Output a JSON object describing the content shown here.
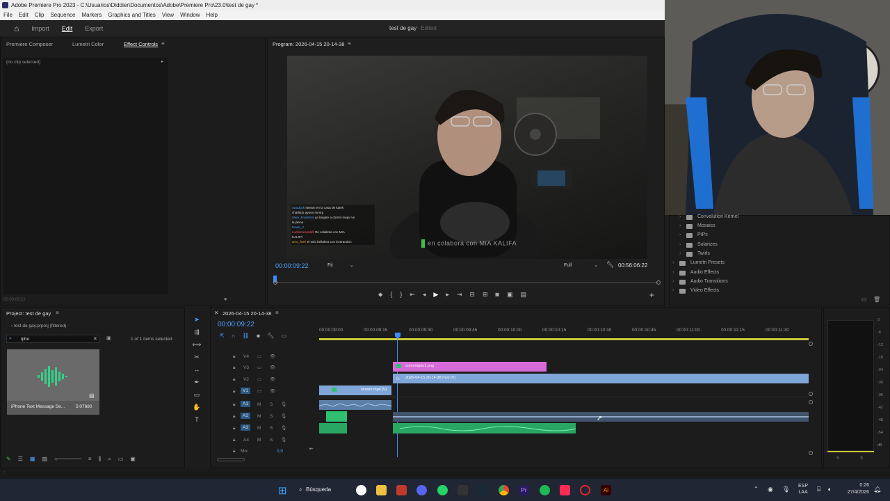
{
  "titlebar": {
    "title": "Adobe Premiere Pro 2023 - C:\\Usuarios\\Diddier\\Documentos\\Adobe\\Premiere Pro\\23.0\\test de gay *"
  },
  "menu": [
    "File",
    "Edit",
    "Clip",
    "Sequence",
    "Markers",
    "Graphics and Titles",
    "View",
    "Window",
    "Help"
  ],
  "workspace": {
    "tabs": [
      "Import",
      "Edit",
      "Export"
    ],
    "active": "Edit",
    "doc_title": "test de gay",
    "doc_status": "Edited"
  },
  "source_panel": {
    "tabs": [
      "Premiere Composer",
      "Lumetri Color",
      "Effect Controls"
    ],
    "active": "Effect Controls",
    "no_clip": "(no clip selected)",
    "timecode": "00:00:09:22"
  },
  "program": {
    "title": "Program: 2026-04-15 20-14-38",
    "timecode": "00:00:09:22",
    "fit": "Fit",
    "quality": "Full",
    "duration": "00:56:06:22",
    "caption": "en colabora con MIA KALIFA",
    "chat": [
      {
        "user": "uwuduck",
        "msg": "stream en la casa de kaleh",
        "color": "#4ea0ff"
      },
      {
        "user": "charlitdo",
        "msg": "ayooo nvmrg",
        "color": "#dddddd"
      },
      {
        "user": "Mary_broderick",
        "msg": "ya lárgate a dormir mejor ve",
        "color": "#4ea0ff"
      },
      {
        "user": "",
        "msg": "la plena",
        "color": "#dddddd"
      },
      {
        "user": "Kevin_V",
        "msg": "",
        "color": "#4ea0ff"
      },
      {
        "user": "Luchitoxxvndell",
        "msg": "Oe colabora con MIA",
        "color": "#ff5a5a"
      },
      {
        "user": "",
        "msg": "KALIFA",
        "color": "#dddddd"
      },
      {
        "user": "arco_fo97",
        "msg": "el solo bellakea con la Brandon",
        "color": "#ffa43b"
      }
    ]
  },
  "effects": {
    "items": [
      {
        "label": "Convolution Kernel",
        "level": 1
      },
      {
        "label": "Mosaics",
        "level": 1
      },
      {
        "label": "PIPs",
        "level": 1
      },
      {
        "label": "Solarizes",
        "level": 1
      },
      {
        "label": "Twirls",
        "level": 1
      },
      {
        "label": "Lumetri Presets",
        "level": 0
      },
      {
        "label": "Audio Effects",
        "level": 0
      },
      {
        "label": "Audio Transitions",
        "level": 0
      },
      {
        "label": "Video Effects",
        "level": 0
      }
    ]
  },
  "project": {
    "title": "Project: test de gay",
    "file": "test de gay.prproj (filtered)",
    "search": "ipho",
    "selection": "1 of 1 items selected",
    "item_name": "iPhone Text Message Se...",
    "item_duration": "5:07680"
  },
  "timeline": {
    "sequence": "2026-04-15 20-14-38",
    "timecode": "00:00:09:22",
    "ruler": [
      "00:00:09:00",
      "00:00:09:15",
      "00:00:09:30",
      "00:00:09:45",
      "00:00:10:00",
      "00:00:10:15",
      "00:00:10:30",
      "00:00:10:45",
      "00:00:11:00",
      "00:00:11:15",
      "00:00:11:30"
    ],
    "video_tracks": [
      "V4",
      "V3",
      "V2",
      "V1"
    ],
    "audio_tracks": [
      "A1",
      "A2",
      "A3",
      "A4"
    ],
    "mix_label": "Mix",
    "mix_value": "0,0",
    "clips": {
      "comentario": "comentario1.png",
      "main_video": "2026-04-15 20-14-38.mov [V]",
      "screen": "screen.mp4 [V]"
    }
  },
  "meter": {
    "labels": [
      "0",
      "-6",
      "-12",
      "-18",
      "-24",
      "-30",
      "-36",
      "-42",
      "-48",
      "-54",
      "dB"
    ],
    "bottom": [
      "S",
      "S"
    ]
  },
  "taskbar": {
    "search": "Búsqueda",
    "lang_top": "ESP",
    "lang_bottom": "LAA",
    "time": "0:26",
    "date": "27/4/2026",
    "apps": [
      "chrome-icon",
      "files-icon",
      "youtube-icon",
      "discord-icon",
      "whatsapp-icon",
      "epic-icon",
      "steam-icon",
      "chrome-icon",
      "premiere-icon",
      "spotify-icon",
      "tiktok-icon",
      "opera-icon",
      "illustrator-icon"
    ]
  },
  "colors": {
    "accent": "#4ea0ff",
    "pink_clip": "#d86ad8",
    "blue_clip": "#7fa6d9",
    "audio_green": "#2fbf71",
    "playhead": "#3b8bff"
  }
}
